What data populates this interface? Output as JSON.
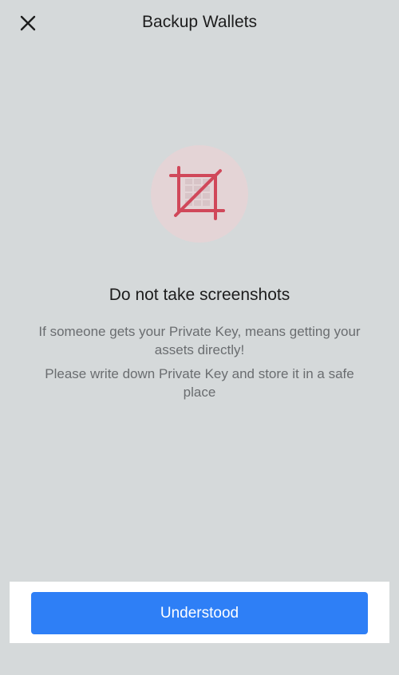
{
  "header": {
    "title": "Backup Wallets",
    "close_icon": "close-icon"
  },
  "illustration": {
    "icon": "no-screenshot-crop-icon",
    "color": "#d0485a",
    "circle_color": "#e4d4d6"
  },
  "content": {
    "heading": "Do not take screenshots",
    "line1": "If someone gets your Private Key, means getting your assets directly!",
    "line2": "Please write down Private Key and store it in a safe place"
  },
  "footer": {
    "button_label": "Understood",
    "button_color": "#2e7ff6"
  }
}
